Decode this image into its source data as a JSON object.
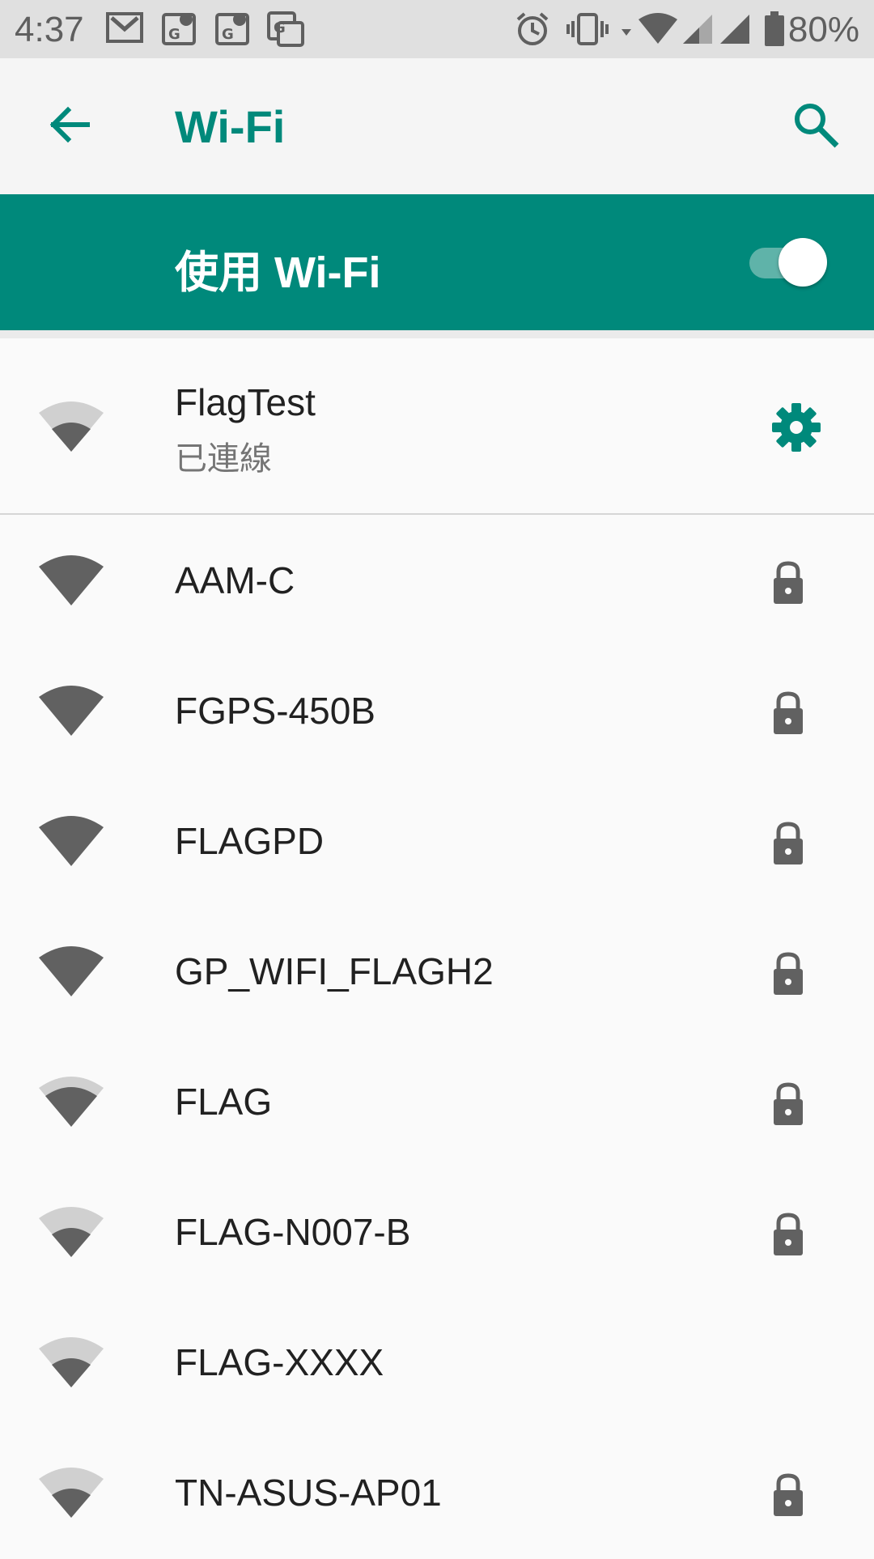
{
  "status_bar": {
    "time": "4:37",
    "battery": "80%",
    "icons": [
      "gmail-icon",
      "maps-icon",
      "maps-icon",
      "translate-icon",
      "alarm-icon",
      "vibrate-icon",
      "wifi-icon",
      "signal-icon",
      "signal-icon",
      "battery-icon"
    ]
  },
  "app_bar": {
    "title": "Wi-Fi",
    "back_icon": "arrow-back-icon",
    "search_icon": "search-icon"
  },
  "master_switch": {
    "label": "使用 Wi-Fi",
    "enabled": true
  },
  "connected_network": {
    "ssid": "FlagTest",
    "status": "已連線",
    "signal_level": 2,
    "action_icon": "gear-icon"
  },
  "networks": [
    {
      "ssid": "AAM-C",
      "signal_level": 4,
      "secured": true
    },
    {
      "ssid": "FGPS-450B",
      "signal_level": 4,
      "secured": true
    },
    {
      "ssid": "FLAGPD",
      "signal_level": 4,
      "secured": true
    },
    {
      "ssid": "GP_WIFI_FLAGH2",
      "signal_level": 4,
      "secured": true
    },
    {
      "ssid": "FLAG",
      "signal_level": 3,
      "secured": true
    },
    {
      "ssid": "FLAG-N007-B",
      "signal_level": 2,
      "secured": true
    },
    {
      "ssid": "FLAG-XXXX",
      "signal_level": 2,
      "secured": false
    },
    {
      "ssid": "TN-ASUS-AP01",
      "signal_level": 2,
      "secured": true
    }
  ],
  "colors": {
    "accent": "#00897b",
    "icon_dark": "#616161",
    "icon_light": "#d0d0d0"
  }
}
